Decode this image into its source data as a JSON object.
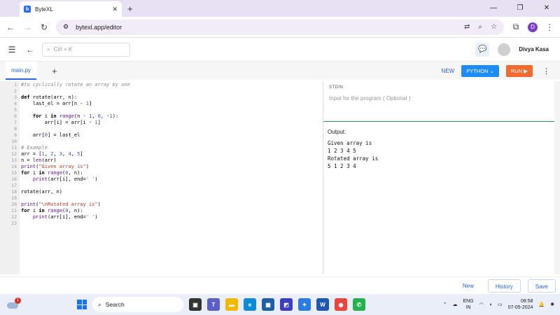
{
  "browser": {
    "tab_title": "ByteXL",
    "tab_favicon": "b",
    "new_tab": "+",
    "url": "bytexl.app/editor",
    "profile_initial": "D"
  },
  "header": {
    "search_placeholder": "Ctrl + K",
    "username": "Divya Kasa"
  },
  "editor": {
    "file_tab": "main.py",
    "new_label": "NEW",
    "language_label": "PYTHON",
    "run_label": "RUN",
    "line_numbers": [
      "1",
      "2",
      "3",
      "4",
      "5",
      "6",
      "7",
      "8",
      "9",
      "10",
      "11",
      "12",
      "13",
      "14",
      "15",
      "16",
      "17",
      "18",
      "19",
      "20",
      "21",
      "22",
      "23"
    ],
    "code_lines": [
      "#to cyclically rotate an array by one",
      "",
      "def rotate(arr, n):",
      "    last_el = arr[n - 1]",
      "",
      "    for i in range(n - 1, 0, -1):",
      "        arr[i] = arr[i - 1]",
      "",
      "    arr[0] = last_el",
      "",
      "# Example",
      "arr = [1, 2, 3, 4, 5]",
      "n = len(arr)",
      "print(\"Given array is\")",
      "for i in range(0, n):",
      "    print(arr[i], end=' ')",
      "",
      "rotate(arr, n)",
      "",
      "print(\"\\nRotated array is\")",
      "for i in range(0, n):",
      "    print(arr[i], end=' ')",
      ""
    ]
  },
  "stdin": {
    "label": "STDIN",
    "placeholder": "Input for the program ( Optional )"
  },
  "output": {
    "label": "Output:",
    "lines": [
      "Given array is",
      "1 2 3 4 5",
      "Rotated array is",
      "5 1 2 3 4"
    ]
  },
  "footer": {
    "new_label": "New",
    "history_label": "History",
    "save_label": "Save"
  },
  "taskbar": {
    "weather_badge": "1",
    "search_label": "Search",
    "lang_line1": "ENG",
    "lang_line2": "IN",
    "time": "08:58",
    "date": "07-05-2024"
  },
  "colors": {
    "accent_blue": "#1d8cf8",
    "run_orange": "#f26a2e",
    "stdin_border": "#2e9b55"
  }
}
